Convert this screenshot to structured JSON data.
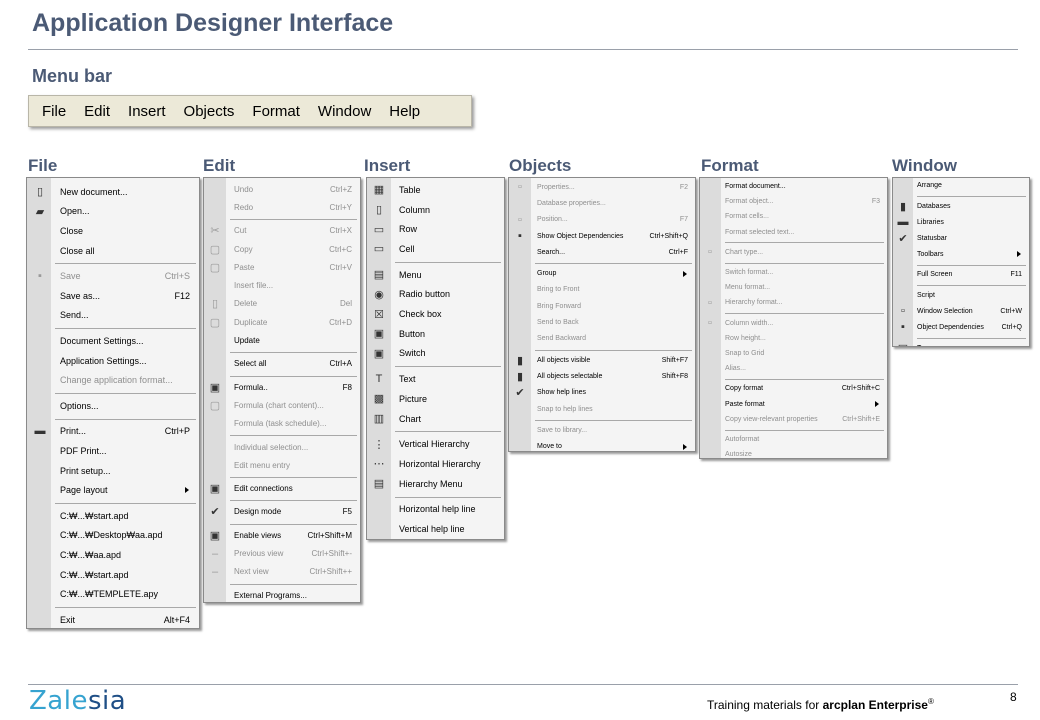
{
  "page": {
    "title": "Application Designer Interface",
    "subtitle": "Menu bar",
    "footer_prefix": "Training  materials for ",
    "footer_product": "arcplan Enterprise",
    "footer_reg": "®",
    "page_number": "8",
    "logo_a": "Zale",
    "logo_b": "sia"
  },
  "menubar": [
    "File",
    "Edit",
    "Insert",
    "Objects",
    "Format",
    "Window",
    "Help"
  ],
  "column_titles": [
    "File",
    "Edit",
    "Insert",
    "Objects",
    "Format",
    "Window"
  ],
  "menus": {
    "file": [
      {
        "label": "New document...",
        "icon": "new-document-icon",
        "glyph": "▯"
      },
      {
        "label": "Open...",
        "icon": "folder-icon",
        "glyph": "▰"
      },
      {
        "label": "Close"
      },
      {
        "label": "Close all"
      },
      {
        "sep": true
      },
      {
        "label": "Save",
        "shortcut": "Ctrl+S",
        "disabled": true,
        "icon": "save-icon",
        "glyph": "▪"
      },
      {
        "label": "Save as...",
        "shortcut": "F12"
      },
      {
        "label": "Send..."
      },
      {
        "sep": true
      },
      {
        "label": "Document Settings..."
      },
      {
        "label": "Application Settings..."
      },
      {
        "label": "Change application format...",
        "disabled": true
      },
      {
        "sep": true
      },
      {
        "label": "Options..."
      },
      {
        "sep": true
      },
      {
        "label": "Print...",
        "shortcut": "Ctrl+P",
        "icon": "printer-icon",
        "glyph": "▬"
      },
      {
        "label": "PDF Print..."
      },
      {
        "label": "Print setup..."
      },
      {
        "label": "Page layout",
        "submenu": true
      },
      {
        "sep": true
      },
      {
        "label": "C:₩...₩start.apd"
      },
      {
        "label": "C:₩...₩Desktop₩aa.apd"
      },
      {
        "label": "C:₩...₩aa.apd"
      },
      {
        "label": "C:₩...₩start.apd"
      },
      {
        "label": "C:₩...₩TEMPLETE.apy"
      },
      {
        "sep": true
      },
      {
        "label": "Exit",
        "shortcut": "Alt+F4"
      }
    ],
    "edit": [
      {
        "label": "Undo",
        "shortcut": "Ctrl+Z",
        "disabled": true
      },
      {
        "label": "Redo",
        "shortcut": "Ctrl+Y",
        "disabled": true
      },
      {
        "sep": true
      },
      {
        "label": "Cut",
        "shortcut": "Ctrl+X",
        "disabled": true,
        "icon": "cut-icon",
        "glyph": "✂"
      },
      {
        "label": "Copy",
        "shortcut": "Ctrl+C",
        "disabled": true,
        "icon": "copy-icon",
        "glyph": "▢"
      },
      {
        "label": "Paste",
        "shortcut": "Ctrl+V",
        "disabled": true,
        "icon": "paste-icon",
        "glyph": "▢"
      },
      {
        "label": "Insert file...",
        "disabled": true
      },
      {
        "label": "Delete",
        "shortcut": "Del",
        "disabled": true,
        "icon": "delete-icon",
        "glyph": "▯"
      },
      {
        "label": "Duplicate",
        "shortcut": "Ctrl+D",
        "disabled": true,
        "icon": "duplicate-icon",
        "glyph": "▢"
      },
      {
        "label": "Update"
      },
      {
        "sep": true
      },
      {
        "label": "Select all",
        "shortcut": "Ctrl+A"
      },
      {
        "sep": true
      },
      {
        "label": "Formula..",
        "shortcut": "F8",
        "icon": "formula-icon",
        "glyph": "▣"
      },
      {
        "label": "Formula (chart content)...",
        "disabled": true,
        "icon": "chart-formula-icon",
        "glyph": "▢"
      },
      {
        "label": "Formula (task schedule)...",
        "disabled": true
      },
      {
        "sep": true
      },
      {
        "label": "Individual selection...",
        "disabled": true
      },
      {
        "label": "Edit menu entry",
        "disabled": true
      },
      {
        "sep": true
      },
      {
        "label": "Edit connections",
        "icon": "connections-icon",
        "glyph": "▣"
      },
      {
        "sep": true
      },
      {
        "label": "Design mode",
        "shortcut": "F5",
        "checked": true
      },
      {
        "sep": true
      },
      {
        "label": "Enable views",
        "shortcut": "Ctrl+Shift+M",
        "icon": "views-icon",
        "glyph": "▣"
      },
      {
        "label": "Previous view",
        "shortcut": "Ctrl+Shift+-",
        "disabled": true,
        "icon": "previous-view-icon",
        "glyph": "–"
      },
      {
        "label": "Next view",
        "shortcut": "Ctrl+Shift++",
        "disabled": true,
        "icon": "next-view-icon",
        "glyph": "–"
      },
      {
        "sep": true
      },
      {
        "label": "External Programs..."
      }
    ],
    "insert": [
      {
        "label": "Table",
        "icon": "table-icon",
        "glyph": "▦"
      },
      {
        "label": "Column",
        "icon": "column-icon",
        "glyph": "▯"
      },
      {
        "label": "Row",
        "icon": "row-icon",
        "glyph": "▭"
      },
      {
        "label": "Cell",
        "icon": "cell-icon",
        "glyph": "▭"
      },
      {
        "sep": true
      },
      {
        "label": "Menu",
        "icon": "menu-icon",
        "glyph": "▤"
      },
      {
        "label": "Radio button",
        "icon": "radio-button-icon",
        "glyph": "◉"
      },
      {
        "label": "Check box",
        "icon": "check-box-icon",
        "glyph": "☒"
      },
      {
        "label": "Button",
        "icon": "button-icon",
        "glyph": "▣"
      },
      {
        "label": "Switch",
        "icon": "switch-icon",
        "glyph": "▣"
      },
      {
        "sep": true
      },
      {
        "label": "Text",
        "icon": "text-icon",
        "glyph": "T"
      },
      {
        "label": "Picture",
        "icon": "picture-icon",
        "glyph": "▩"
      },
      {
        "label": "Chart",
        "icon": "chart-icon",
        "glyph": "▥"
      },
      {
        "sep": true
      },
      {
        "label": "Vertical Hierarchy",
        "icon": "vertical-hierarchy-icon",
        "glyph": "⋮"
      },
      {
        "label": "Horizontal Hierarchy",
        "icon": "horizontal-hierarchy-icon",
        "glyph": "⋯"
      },
      {
        "label": "Hierarchy Menu",
        "icon": "hierarchy-menu-icon",
        "glyph": "▤"
      },
      {
        "sep": true
      },
      {
        "label": "Horizontal help line"
      },
      {
        "label": "Vertical help line"
      }
    ],
    "objects": [
      {
        "label": "Properties...",
        "shortcut": "F2",
        "disabled": true,
        "icon": "properties-icon",
        "glyph": "▫"
      },
      {
        "label": "Database properties...",
        "disabled": true
      },
      {
        "label": "Position...",
        "shortcut": "F7",
        "disabled": true,
        "icon": "position-icon",
        "glyph": "▫"
      },
      {
        "label": "Show Object Dependencies",
        "shortcut": "Ctrl+Shift+Q",
        "icon": "object-dependencies-icon",
        "glyph": "▪"
      },
      {
        "label": "Search...",
        "shortcut": "Ctrl+F"
      },
      {
        "sep": true
      },
      {
        "label": "Group",
        "submenu": true
      },
      {
        "label": "Bring to Front",
        "disabled": true
      },
      {
        "label": "Bring Forward",
        "disabled": true
      },
      {
        "label": "Send to Back",
        "disabled": true
      },
      {
        "label": "Send Backward",
        "disabled": true
      },
      {
        "sep": true
      },
      {
        "label": "All objects visible",
        "shortcut": "Shift+F7",
        "icon": "visible-icon",
        "glyph": "▮"
      },
      {
        "label": "All objects selectable",
        "shortcut": "Shift+F8",
        "icon": "selectable-icon",
        "glyph": "▮"
      },
      {
        "label": "Show help lines",
        "checked": true
      },
      {
        "label": "Snap to help lines",
        "disabled": true
      },
      {
        "sep": true
      },
      {
        "label": "Save to library...",
        "disabled": true
      },
      {
        "label": "Move to",
        "submenu": true
      }
    ],
    "format": [
      {
        "label": "Format document..."
      },
      {
        "label": "Format object...",
        "shortcut": "F3",
        "disabled": true
      },
      {
        "label": "Format cells...",
        "disabled": true
      },
      {
        "label": "Format selected text...",
        "disabled": true
      },
      {
        "sep": true
      },
      {
        "label": "Chart type...",
        "disabled": true,
        "icon": "chart-type-icon",
        "glyph": "▫"
      },
      {
        "sep": true
      },
      {
        "label": "Switch format...",
        "disabled": true
      },
      {
        "label": "Menu format...",
        "disabled": true
      },
      {
        "label": "Hierarchy format...",
        "disabled": true,
        "icon": "hierarchy-format-icon",
        "glyph": "▫"
      },
      {
        "sep": true
      },
      {
        "label": "Column width...",
        "disabled": true,
        "icon": "column-width-icon",
        "glyph": "▫"
      },
      {
        "label": "Row height...",
        "disabled": true
      },
      {
        "label": "Snap to Grid",
        "disabled": true
      },
      {
        "label": "Alias...",
        "disabled": true
      },
      {
        "sep": true
      },
      {
        "label": "Copy format",
        "shortcut": "Ctrl+Shift+C"
      },
      {
        "label": "Paste format",
        "submenu": true
      },
      {
        "label": "Copy view-relevant properties",
        "shortcut": "Ctrl+Shift+E",
        "disabled": true
      },
      {
        "sep": true
      },
      {
        "label": "Autoformat",
        "disabled": true
      },
      {
        "label": "Autosize",
        "disabled": true
      }
    ],
    "window": [
      {
        "label": "Arrange"
      },
      {
        "sep": true
      },
      {
        "label": "Databases",
        "icon": "databases-icon",
        "glyph": "▮"
      },
      {
        "label": "Libraries",
        "icon": "libraries-icon",
        "glyph": "▬"
      },
      {
        "label": "Statusbar",
        "checked": true
      },
      {
        "label": "Toolbars",
        "submenu": true
      },
      {
        "sep": true
      },
      {
        "label": "Full Screen",
        "shortcut": "F11"
      },
      {
        "sep": true
      },
      {
        "label": "Script"
      },
      {
        "label": "Window Selection",
        "shortcut": "Ctrl+W",
        "icon": "window-selection-icon",
        "glyph": "▫"
      },
      {
        "label": "Object Dependencies",
        "shortcut": "Ctrl+Q",
        "icon": "dependencies-icon",
        "glyph": "▪"
      },
      {
        "sep": true
      },
      {
        "label": "Trace",
        "icon": "trace-icon",
        "glyph": "▣"
      }
    ]
  }
}
